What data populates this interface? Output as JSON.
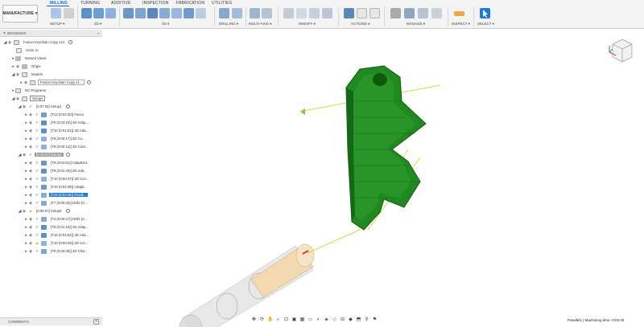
{
  "toolbar": {
    "workspace": "MANUFACTURE",
    "tabs": [
      "MILLING",
      "TURNING",
      "ADDITIVE",
      "INSPECTION",
      "FABRICATION",
      "UTILITIES"
    ],
    "groups": [
      "SETUP ▾",
      "2D ▾",
      "3D ▾",
      "DRILLING ▾",
      "MULTI-AXIS ▾",
      "MODIFY ▾",
      "ACTIONS ▾",
      "MANAGE ▾",
      "INSPECT ▾",
      "SELECT ▾"
    ]
  },
  "browser": {
    "title": "BROWSER",
    "items": [
      {
        "label": "Fusion Keychain Copy v14"
      },
      {
        "label": "Units: in"
      },
      {
        "label": "Named Views"
      },
      {
        "label": "Origin"
      },
      {
        "label": "Models"
      },
      {
        "label": "Fusion Keychain Copy v1..."
      },
      {
        "label": "NC Programs"
      },
      {
        "label": "Setups"
      },
      {
        "label": "[0:07:02] Setup1"
      },
      {
        "label": "[T13 (0:02:20)] Face1"
      },
      {
        "label": "[T9 (0:03:10)] 2D Adap..."
      },
      {
        "label": "[T10 (0:01:01)] 2D Ada..."
      },
      {
        "label": "[T9 (0:00:17)] 2D Co..."
      },
      {
        "label": "[T8 (0:00:12)] 2D Cont..."
      },
      {
        "label": "[0:16:37] Setup2"
      },
      {
        "label": "[T9 (0:04:51)] Adaptive1"
      },
      {
        "label": "[T9 (0:01:40)] 2D Ada..."
      },
      {
        "label": "[T10 (0:00:37)] 2D Con..."
      },
      {
        "label": "[T15 (0:04:38)] Adapti..."
      },
      {
        "label": "[T15 (0:03:46)] Parall..."
      },
      {
        "label": "[T7 (0:00:03)] Drill2 [C..."
      },
      {
        "label": "[0:00:07] Setup3"
      },
      {
        "label": "[T4 (0:00:17)] Drill1 [C..."
      },
      {
        "label": "[T9 (0:21:10)] 2D Adap..."
      },
      {
        "label": "[T10 (0:02:52)] 2D Ada..."
      },
      {
        "label": "[T10 (0:00:33)] 2D Cor..."
      },
      {
        "label": "[T8 (0:00:30)] 2D Char..."
      }
    ]
  },
  "comments": "COMMENTS",
  "status": "Parallel1 | Machining time: 0:03:46",
  "colors": {
    "accent": "#0c6cd4",
    "part_green": "#1f8a1f",
    "tool_tip": "#f2d9b0",
    "toolpath": "#c8d200"
  }
}
